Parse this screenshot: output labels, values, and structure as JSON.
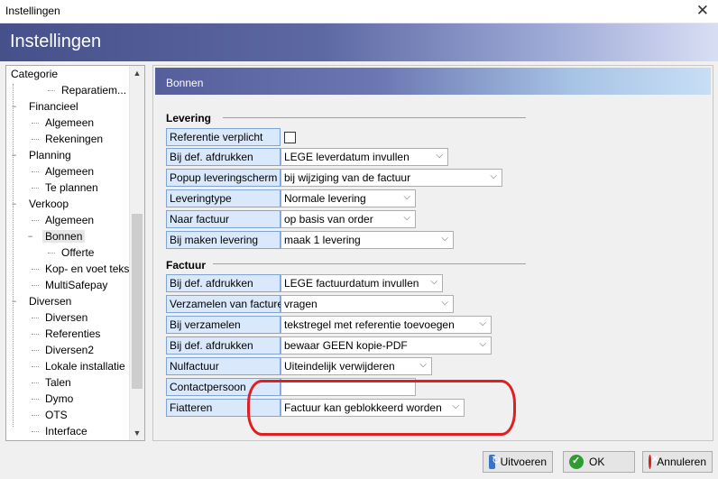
{
  "window": {
    "title": "Instellingen",
    "banner_title": "Instellingen"
  },
  "tree": {
    "header": "Categorie",
    "items": [
      {
        "label": "Reparatiem...",
        "level": 2,
        "expander": ""
      },
      {
        "label": "Financieel",
        "level": 0,
        "expander": "−"
      },
      {
        "label": "Algemeen",
        "level": 1,
        "expander": ""
      },
      {
        "label": "Rekeningen",
        "level": 1,
        "expander": ""
      },
      {
        "label": "Planning",
        "level": 0,
        "expander": "−"
      },
      {
        "label": "Algemeen",
        "level": 1,
        "expander": ""
      },
      {
        "label": "Te plannen",
        "level": 1,
        "expander": ""
      },
      {
        "label": "Verkoop",
        "level": 0,
        "expander": "−"
      },
      {
        "label": "Algemeen",
        "level": 1,
        "expander": ""
      },
      {
        "label": "Bonnen",
        "level": 1,
        "expander": "−",
        "selected": true
      },
      {
        "label": "Offerte",
        "level": 2,
        "expander": ""
      },
      {
        "label": "Kop- en voet tekst",
        "level": 1,
        "expander": ""
      },
      {
        "label": "MultiSafepay",
        "level": 1,
        "expander": ""
      },
      {
        "label": "Diversen",
        "level": 0,
        "expander": "−"
      },
      {
        "label": "Diversen",
        "level": 1,
        "expander": ""
      },
      {
        "label": "Referenties",
        "level": 1,
        "expander": ""
      },
      {
        "label": "Diversen2",
        "level": 1,
        "expander": ""
      },
      {
        "label": "Lokale installatie",
        "level": 1,
        "expander": ""
      },
      {
        "label": "Talen",
        "level": 1,
        "expander": ""
      },
      {
        "label": "Dymo",
        "level": 1,
        "expander": ""
      },
      {
        "label": "OTS",
        "level": 1,
        "expander": ""
      },
      {
        "label": "Interface",
        "level": 1,
        "expander": ""
      }
    ]
  },
  "panel": {
    "title": "Bonnen",
    "levering": {
      "heading": "Levering",
      "fields": [
        {
          "label": "Referentie verplicht",
          "type": "checkbox",
          "checked": false
        },
        {
          "label": "Bij def. afdrukken",
          "type": "select",
          "value": "LEGE leverdatum invullen"
        },
        {
          "label": "Popup leveringscherm",
          "type": "select",
          "value": "bij wijziging van de factuur"
        },
        {
          "label": "Leveringtype",
          "type": "select",
          "value": "Normale levering"
        },
        {
          "label": "Naar factuur",
          "type": "select",
          "value": "op basis van order"
        },
        {
          "label": "Bij maken levering",
          "type": "select",
          "value": "maak 1 levering"
        }
      ]
    },
    "factuur": {
      "heading": "Factuur",
      "fields": [
        {
          "label": "Bij def. afdrukken",
          "type": "select",
          "value": "LEGE factuurdatum invullen"
        },
        {
          "label": "Verzamelen van facturen",
          "type": "select",
          "value": "vragen"
        },
        {
          "label": "Bij verzamelen",
          "type": "select",
          "value": "tekstregel met referentie toevoegen"
        },
        {
          "label": "Bij def. afdrukken",
          "type": "select",
          "value": "bewaar GEEN kopie-PDF"
        },
        {
          "label": "Nulfactuur",
          "type": "select",
          "value": "Uiteindelijk verwijderen"
        },
        {
          "label": "Contactpersoon",
          "type": "text",
          "value": ""
        },
        {
          "label": "Fiatteren",
          "type": "select",
          "value": "Factuur kan geblokkeerd worden"
        }
      ]
    }
  },
  "buttons": {
    "execute": "Uitvoeren",
    "ok": "OK",
    "cancel": "Annuleren"
  },
  "colors": {
    "highlight_circle": "#e02020",
    "label_bg": "#d9e9fb"
  }
}
